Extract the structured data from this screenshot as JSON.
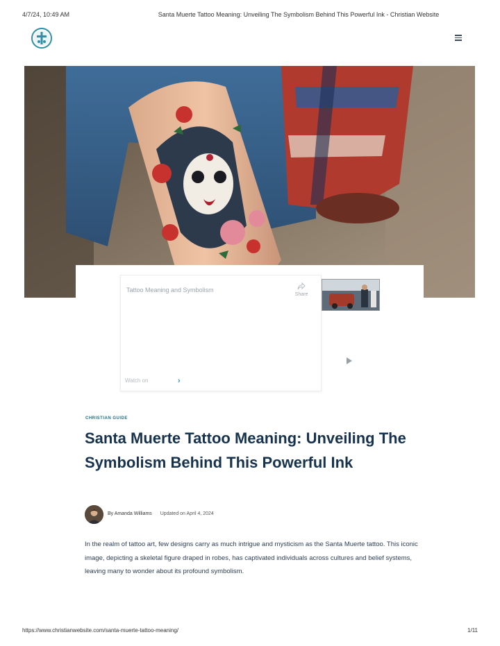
{
  "print_header": {
    "datetime": "4/7/24, 10:49 AM",
    "title": "Santa Muerte Tattoo Meaning: Unveiling The Symbolism Behind This Powerful Ink - Christian Website"
  },
  "site": {
    "logo_icon": "cross-circle-logo-icon",
    "menu_icon": "hamburger-menu-icon",
    "accent_color": "#1d6f85"
  },
  "hero": {
    "image": "tattooed-forearm-santa-muerte-illustration"
  },
  "video": {
    "title": "Tattoo Meaning and Symbolism",
    "share_label": "Share",
    "watch_label": "Watch on",
    "chevron": "›"
  },
  "article": {
    "category": "CHRISTIAN GUIDE",
    "title": "Santa Muerte Tattoo Meaning: Unveiling The Symbolism Behind This Powerful Ink",
    "author": "By Amanda Williams",
    "updated": "Updated on April 4, 2024",
    "intro": "In the realm of tattoo art, few designs carry as much intrigue and mysticism as the Santa Muerte tattoo. This iconic image, depicting a skeletal figure draped in robes, has captivated individuals across cultures and belief systems, leaving many to wonder about its profound symbolism."
  },
  "print_footer": {
    "url": "https://www.christianwebsite.com/santa-muerte-tattoo-meaning/",
    "page": "1/11"
  }
}
